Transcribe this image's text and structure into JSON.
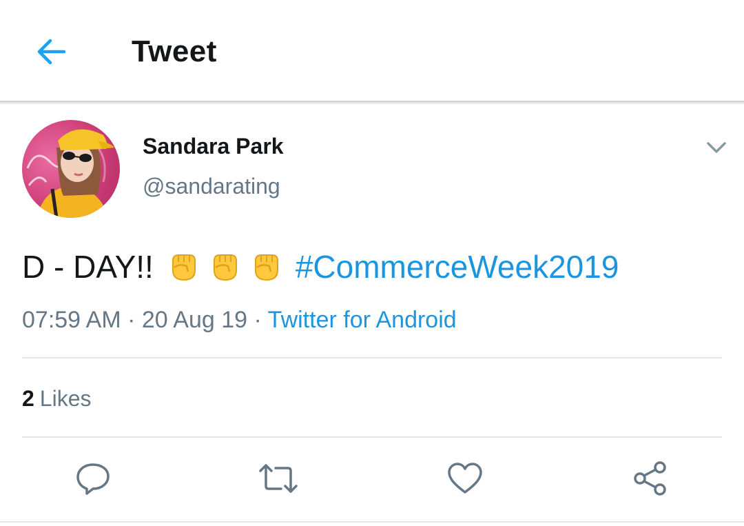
{
  "header": {
    "title": "Tweet",
    "back_icon": "arrow-left-icon",
    "accent_color": "#1da1f2"
  },
  "tweet": {
    "author_name": "Sandara Park",
    "author_handle": "@sandarating",
    "text_prefix": "D - DAY!!",
    "emoji": [
      "✊",
      "✊",
      "✊"
    ],
    "hashtag": "#CommerceWeek2019",
    "time": "07:59 AM",
    "date": "20 Aug 19",
    "separator": "·",
    "source": "Twitter for Android"
  },
  "stats": {
    "likes_count": "2",
    "likes_label": "Likes"
  },
  "actions": {
    "reply_icon": "reply-icon",
    "retweet_icon": "retweet-icon",
    "like_icon": "heart-icon",
    "share_icon": "share-icon"
  },
  "colors": {
    "text_primary": "#14171a",
    "text_secondary": "#657786",
    "link": "#1b95e0",
    "divider": "#e1e8ed"
  }
}
